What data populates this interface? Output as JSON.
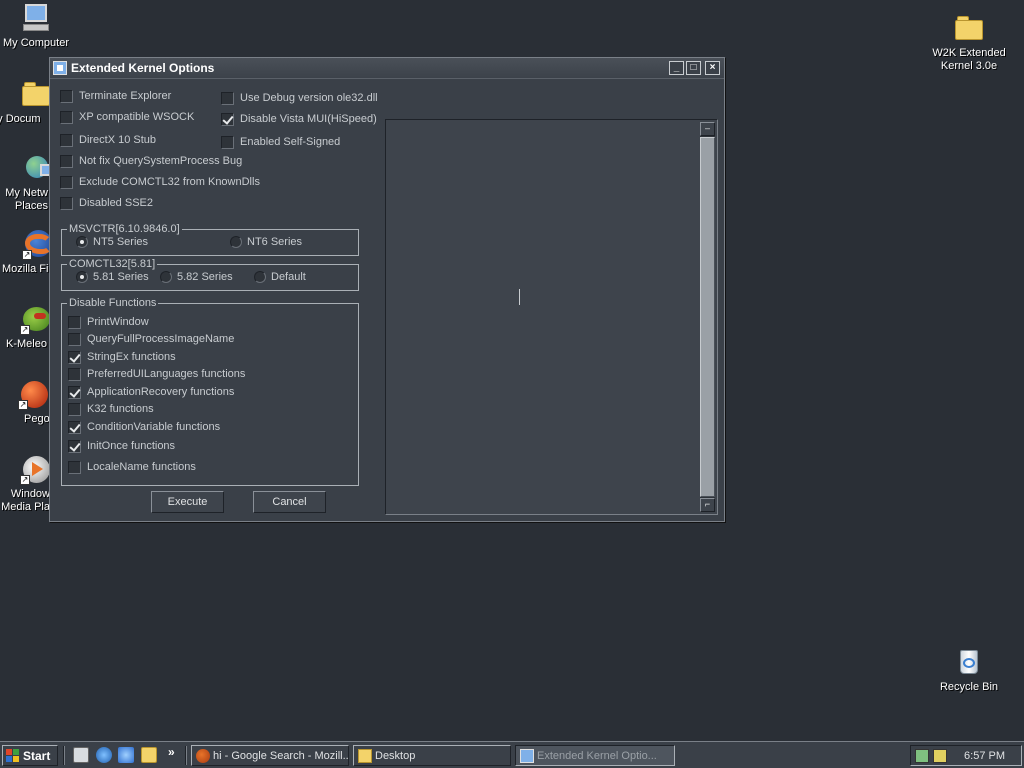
{
  "desktop": {
    "icons": {
      "my_computer": "My Computer",
      "my_documents": "My Docum",
      "my_network": "My Netw\nPlaces",
      "firefox": "Mozilla Fir",
      "kmeleon": "K-Meleo",
      "pego": "Pego",
      "wmp": "Window\nMedia Pla",
      "w2k_folder": "W2K Extended\nKernel 3.0e",
      "recycle_bin": "Recycle Bin"
    }
  },
  "window": {
    "title": "Extended Kernel Options",
    "minimize_glyph": "_",
    "maximize_glyph": "□",
    "close_glyph": "×",
    "options_left": [
      {
        "label": "Terminate Explorer",
        "checked": false
      },
      {
        "label": "XP compatible WSOCK",
        "checked": false
      },
      {
        "label": "DirectX 10 Stub",
        "checked": false
      },
      {
        "label": "Not fix QuerySystemProcess Bug",
        "checked": false
      },
      {
        "label": "Exclude COMCTL32 from KnownDlls",
        "checked": false
      },
      {
        "label": "Disabled SSE2",
        "checked": false
      }
    ],
    "options_right": [
      {
        "label": "Use Debug version ole32.dll",
        "checked": false
      },
      {
        "label": "Disable Vista MUI(HiSpeed)",
        "checked": true
      },
      {
        "label": "Enabled Self-Signed",
        "checked": false
      }
    ],
    "msvcrt": {
      "legend": "MSVCTR[6.10.9846.0]",
      "options": [
        {
          "label": "NT5 Series",
          "selected": true
        },
        {
          "label": "NT6 Series",
          "selected": false
        }
      ]
    },
    "comctl": {
      "legend": "COMCTL32[5.81]",
      "options": [
        {
          "label": "5.81 Series",
          "selected": true
        },
        {
          "label": "5.82 Series",
          "selected": false
        },
        {
          "label": "Default",
          "selected": false
        }
      ]
    },
    "disable_functions": {
      "legend": "Disable Functions",
      "items": [
        {
          "label": "PrintWindow",
          "checked": false
        },
        {
          "label": "QueryFullProcessImageName",
          "checked": false
        },
        {
          "label": "StringEx functions",
          "checked": true
        },
        {
          "label": "PreferredUILanguages functions",
          "checked": false
        },
        {
          "label": "ApplicationRecovery functions",
          "checked": true
        },
        {
          "label": "K32 functions",
          "checked": false
        },
        {
          "label": "ConditionVariable functions",
          "checked": true
        },
        {
          "label": "InitOnce functions",
          "checked": true
        },
        {
          "label": "LocaleName functions",
          "checked": false
        }
      ]
    },
    "execute_label": "Execute",
    "cancel_label": "Cancel",
    "scroll_up_glyph": "–",
    "scroll_down_glyph": "⌐"
  },
  "taskbar": {
    "start_label": "Start",
    "chevron": "»",
    "tasks": [
      {
        "label": "hi - Google Search - Mozill...",
        "active": false
      },
      {
        "label": "Desktop",
        "active": false
      },
      {
        "label": "Extended Kernel Optio...",
        "active": true
      }
    ],
    "clock": "6:57 PM"
  },
  "colors": {
    "desktop_bg": "#2a2f36",
    "window_bg": "#3a4048",
    "text": "#c8ccd0"
  }
}
